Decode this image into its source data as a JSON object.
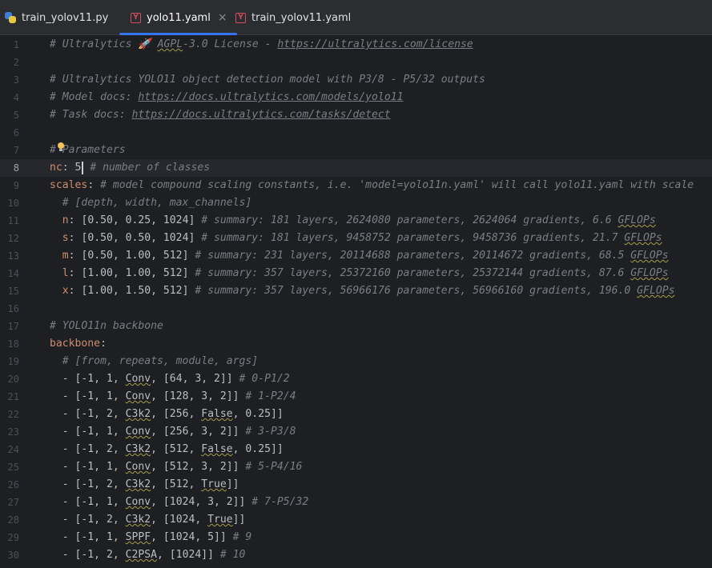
{
  "tabs": [
    {
      "label": "train_yolov11.py",
      "icon": "python-icon",
      "active": false
    },
    {
      "label": "yolo11.yaml",
      "icon": "yaml-icon",
      "active": true,
      "close": "×"
    },
    {
      "label": "train_yolov11.yaml",
      "icon": "yaml-icon",
      "active": false
    }
  ],
  "yaml_icon_glyph": "Y",
  "colors": {
    "accent": "#3574f0",
    "comment": "#7a7e85",
    "key": "#cf8e6d",
    "number": "#2aacb8",
    "text": "#bcbec4",
    "background": "#1e1f22"
  },
  "editor": {
    "current_line": 8,
    "lines": [
      {
        "num": "1",
        "segs": [
          {
            "t": "# Ultralytics 🚀 ",
            "c": "c"
          },
          {
            "t": "AGPL",
            "c": "c sq"
          },
          {
            "t": "-3.0 License - ",
            "c": "c"
          },
          {
            "t": "https://ultralytics.com/license",
            "c": "c l"
          }
        ]
      },
      {
        "num": "2",
        "segs": []
      },
      {
        "num": "3",
        "segs": [
          {
            "t": "# Ultralytics YOLO11 object detection model with P3/8 - P5/32 outputs",
            "c": "c"
          }
        ]
      },
      {
        "num": "4",
        "segs": [
          {
            "t": "# Model docs: ",
            "c": "c"
          },
          {
            "t": "https://docs.ultralytics.com/models/yolo11",
            "c": "c l"
          }
        ]
      },
      {
        "num": "5",
        "segs": [
          {
            "t": "# Task docs: ",
            "c": "c"
          },
          {
            "t": "https://docs.ultralytics.com/tasks/detect",
            "c": "c l"
          }
        ]
      },
      {
        "num": "6",
        "segs": []
      },
      {
        "num": "7",
        "segs": [
          {
            "t": "# Parameters",
            "c": "c"
          }
        ]
      },
      {
        "num": "8",
        "segs": [
          {
            "t": "nc",
            "c": "k"
          },
          {
            "t": ": 5",
            "c": ""
          },
          {
            "t": "",
            "c": "caret"
          },
          {
            "t": " # number of classes",
            "c": "c"
          }
        ]
      },
      {
        "num": "9",
        "segs": [
          {
            "t": "scales",
            "c": "k"
          },
          {
            "t": ": ",
            "c": ""
          },
          {
            "t": "# model compound scaling constants, i.e. 'model=yolo11n.yaml' will call yolo11.yaml with scale",
            "c": "c"
          }
        ]
      },
      {
        "num": "10",
        "segs": [
          {
            "t": "  # [depth, width, max_channels]",
            "c": "c"
          }
        ]
      },
      {
        "num": "11",
        "segs": [
          {
            "t": "  ",
            "c": ""
          },
          {
            "t": "n",
            "c": "k"
          },
          {
            "t": ": [0.50, 0.25, 1024] ",
            "c": ""
          },
          {
            "t": "# summary: 181 layers, 2624080 parameters, 2624064 gradients, 6.6 ",
            "c": "c"
          },
          {
            "t": "GFLOPs",
            "c": "c sq"
          }
        ]
      },
      {
        "num": "12",
        "segs": [
          {
            "t": "  ",
            "c": ""
          },
          {
            "t": "s",
            "c": "k"
          },
          {
            "t": ": [0.50, 0.50, 1024] ",
            "c": ""
          },
          {
            "t": "# summary: 181 layers, 9458752 parameters, 9458736 gradients, 21.7 ",
            "c": "c"
          },
          {
            "t": "GFLOPs",
            "c": "c sq"
          }
        ]
      },
      {
        "num": "13",
        "segs": [
          {
            "t": "  ",
            "c": ""
          },
          {
            "t": "m",
            "c": "k"
          },
          {
            "t": ": [0.50, 1.00, 512] ",
            "c": ""
          },
          {
            "t": "# summary: 231 layers, 20114688 parameters, 20114672 gradients, 68.5 ",
            "c": "c"
          },
          {
            "t": "GFLOPs",
            "c": "c sq"
          }
        ]
      },
      {
        "num": "14",
        "segs": [
          {
            "t": "  ",
            "c": ""
          },
          {
            "t": "l",
            "c": "k"
          },
          {
            "t": ": [1.00, 1.00, 512] ",
            "c": ""
          },
          {
            "t": "# summary: 357 layers, 25372160 parameters, 25372144 gradients, 87.6 ",
            "c": "c"
          },
          {
            "t": "GFLOPs",
            "c": "c sq"
          }
        ]
      },
      {
        "num": "15",
        "segs": [
          {
            "t": "  ",
            "c": ""
          },
          {
            "t": "x",
            "c": "k"
          },
          {
            "t": ": [1.00, 1.50, 512] ",
            "c": ""
          },
          {
            "t": "# summary: 357 layers, 56966176 parameters, 56966160 gradients, 196.0 ",
            "c": "c"
          },
          {
            "t": "GFLOPs",
            "c": "c sq"
          }
        ]
      },
      {
        "num": "16",
        "segs": []
      },
      {
        "num": "17",
        "segs": [
          {
            "t": "# YOLO11n backbone",
            "c": "c"
          }
        ]
      },
      {
        "num": "18",
        "segs": [
          {
            "t": "backbone",
            "c": "k"
          },
          {
            "t": ":",
            "c": ""
          }
        ]
      },
      {
        "num": "19",
        "segs": [
          {
            "t": "  # [from, repeats, module, args]",
            "c": "c"
          }
        ]
      },
      {
        "num": "20",
        "segs": [
          {
            "t": "  - [-1, 1, ",
            "c": ""
          },
          {
            "t": "Conv",
            "c": "sq"
          },
          {
            "t": ", [64, 3, 2]] ",
            "c": ""
          },
          {
            "t": "# 0-P1/2",
            "c": "c"
          }
        ]
      },
      {
        "num": "21",
        "segs": [
          {
            "t": "  - [-1, 1, ",
            "c": ""
          },
          {
            "t": "Conv",
            "c": "sq"
          },
          {
            "t": ", [128, 3, 2]] ",
            "c": ""
          },
          {
            "t": "# 1-P2/4",
            "c": "c"
          }
        ]
      },
      {
        "num": "22",
        "segs": [
          {
            "t": "  - [-1, 2, ",
            "c": ""
          },
          {
            "t": "C3k2",
            "c": "sq"
          },
          {
            "t": ", [256, ",
            "c": ""
          },
          {
            "t": "False",
            "c": "sq"
          },
          {
            "t": ", 0.25]]",
            "c": ""
          }
        ]
      },
      {
        "num": "23",
        "segs": [
          {
            "t": "  - [-1, 1, ",
            "c": ""
          },
          {
            "t": "Conv",
            "c": "sq"
          },
          {
            "t": ", [256, 3, 2]] ",
            "c": ""
          },
          {
            "t": "# 3-P3/8",
            "c": "c"
          }
        ]
      },
      {
        "num": "24",
        "segs": [
          {
            "t": "  - [-1, 2, ",
            "c": ""
          },
          {
            "t": "C3k2",
            "c": "sq"
          },
          {
            "t": ", [512, ",
            "c": ""
          },
          {
            "t": "False",
            "c": "sq"
          },
          {
            "t": ", 0.25]]",
            "c": ""
          }
        ]
      },
      {
        "num": "25",
        "segs": [
          {
            "t": "  - [-1, 1, ",
            "c": ""
          },
          {
            "t": "Conv",
            "c": "sq"
          },
          {
            "t": ", [512, 3, 2]] ",
            "c": ""
          },
          {
            "t": "# 5-P4/16",
            "c": "c"
          }
        ]
      },
      {
        "num": "26",
        "segs": [
          {
            "t": "  - [-1, 2, ",
            "c": ""
          },
          {
            "t": "C3k2",
            "c": "sq"
          },
          {
            "t": ", [512, ",
            "c": ""
          },
          {
            "t": "True",
            "c": "sq"
          },
          {
            "t": "]]",
            "c": ""
          }
        ]
      },
      {
        "num": "27",
        "segs": [
          {
            "t": "  - [-1, 1, ",
            "c": ""
          },
          {
            "t": "Conv",
            "c": "sq"
          },
          {
            "t": ", [1024, 3, 2]] ",
            "c": ""
          },
          {
            "t": "# 7-P5/32",
            "c": "c"
          }
        ]
      },
      {
        "num": "28",
        "segs": [
          {
            "t": "  - [-1, 2, ",
            "c": ""
          },
          {
            "t": "C3k2",
            "c": "sq"
          },
          {
            "t": ", [1024, ",
            "c": ""
          },
          {
            "t": "True",
            "c": "sq"
          },
          {
            "t": "]]",
            "c": ""
          }
        ]
      },
      {
        "num": "29",
        "segs": [
          {
            "t": "  - [-1, 1, ",
            "c": ""
          },
          {
            "t": "SPPF",
            "c": "sq"
          },
          {
            "t": ", [1024, 5]] ",
            "c": ""
          },
          {
            "t": "# 9",
            "c": "c"
          }
        ]
      },
      {
        "num": "30",
        "segs": [
          {
            "t": "  - [-1, 2, ",
            "c": ""
          },
          {
            "t": "C2PSA",
            "c": "sq"
          },
          {
            "t": ", [1024]] ",
            "c": ""
          },
          {
            "t": "# 10",
            "c": "c"
          }
        ]
      }
    ]
  }
}
